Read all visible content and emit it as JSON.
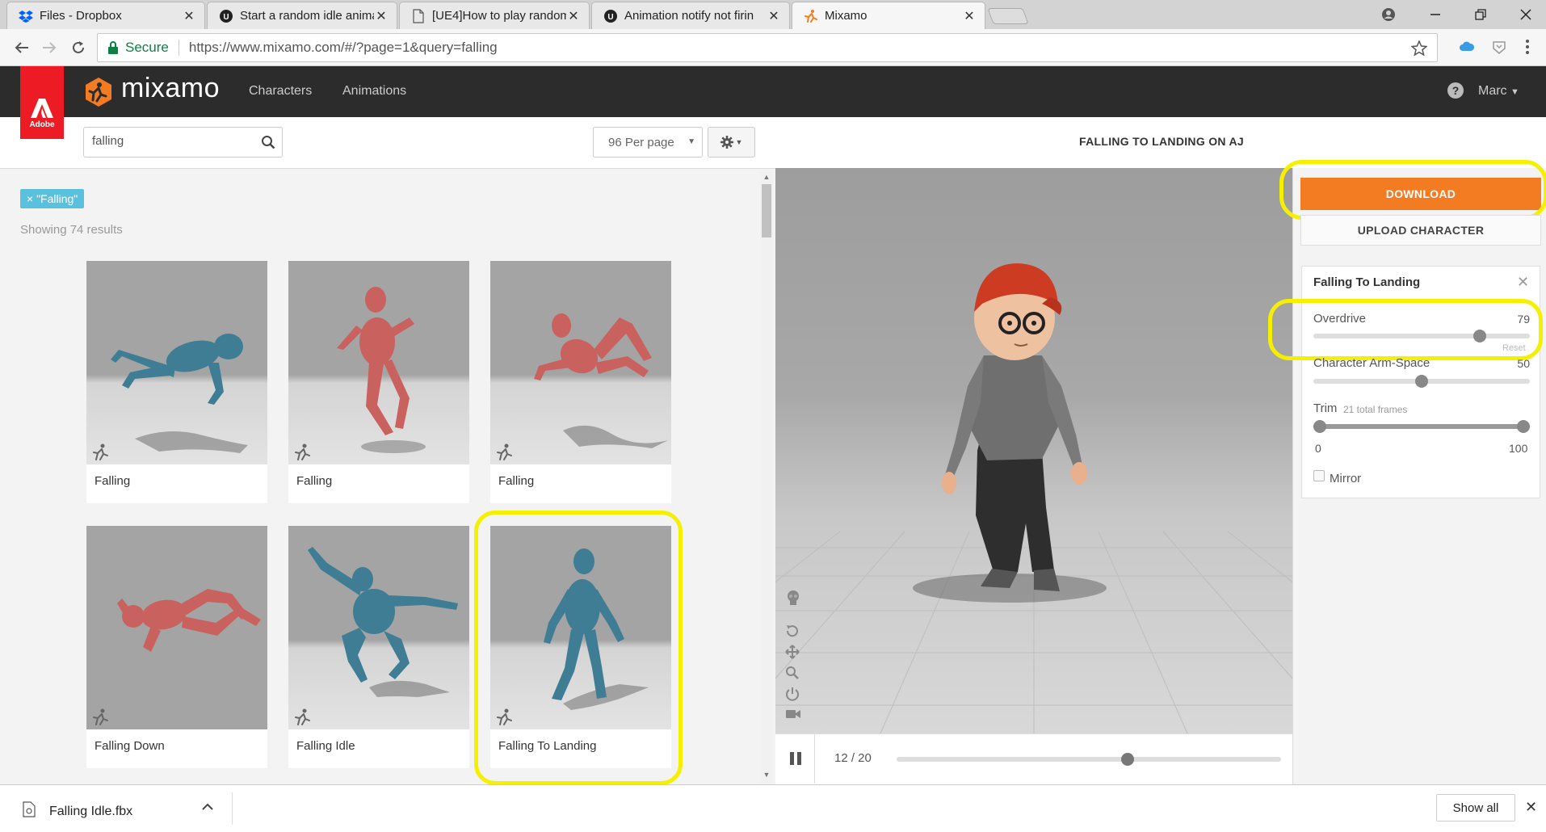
{
  "browser": {
    "tabs": [
      {
        "title": "Files - Dropbox",
        "icon": "dropbox-icon",
        "active": false
      },
      {
        "title": "Start a random idle anima",
        "icon": "unreal-icon",
        "active": false
      },
      {
        "title": "[UE4]How to play random",
        "icon": "document-icon",
        "active": false
      },
      {
        "title": "Animation notify not firin",
        "icon": "unreal-icon",
        "active": false
      },
      {
        "title": "Mixamo",
        "icon": "mixamo-icon",
        "active": true
      }
    ],
    "address": {
      "secure_label": "Secure",
      "url": "https://www.mixamo.com/#/?page=1&query=falling"
    }
  },
  "header": {
    "adobe_label": "Adobe",
    "logo": "mixamo",
    "nav": [
      "Characters",
      "Animations"
    ],
    "user": "Marc"
  },
  "browse": {
    "search_value": "falling",
    "per_page": "96 Per page",
    "filter_tag": "× \"Falling\"",
    "results": "Showing 74 results",
    "cards": [
      {
        "name": "Falling",
        "color": "blue"
      },
      {
        "name": "Falling",
        "color": "red"
      },
      {
        "name": "Falling",
        "color": "red"
      },
      {
        "name": "Falling Down",
        "color": "red"
      },
      {
        "name": "Falling Idle",
        "color": "blue"
      },
      {
        "name": "Falling To Landing",
        "color": "blue",
        "selected": true
      }
    ]
  },
  "viewer": {
    "title": "FALLING TO LANDING ON AJ",
    "frame_current": 12,
    "frame_total": 20,
    "frame_label": "12 / 20"
  },
  "sidebar": {
    "download_label": "DOWNLOAD",
    "upload_label": "UPLOAD CHARACTER",
    "panel_title": "Falling To Landing",
    "overdrive": {
      "label": "Overdrive",
      "value": "79",
      "reset": "Reset"
    },
    "arm_space": {
      "label": "Character Arm-Space",
      "value": "50"
    },
    "trim": {
      "label": "Trim",
      "frames_note": "21 total frames",
      "start": "0",
      "end": "100"
    },
    "mirror_label": "Mirror"
  },
  "shelf": {
    "filename": "Falling Idle.fbx",
    "show_all": "Show all"
  },
  "colors": {
    "accent_orange": "#f37b22",
    "highlight_yellow": "#f5f000",
    "adobe_red": "#ed1c24",
    "tag_blue": "#5bc0de"
  }
}
